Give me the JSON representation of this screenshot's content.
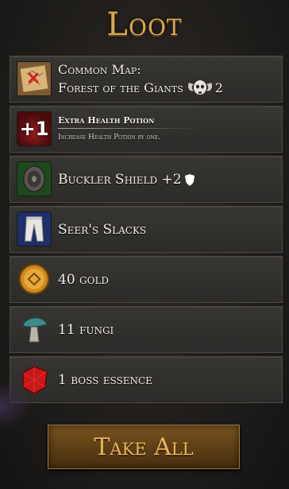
{
  "title": "Loot",
  "items": [
    {
      "lines": [
        "Common Map:",
        "Forest of the Giants"
      ],
      "count": "2",
      "icon": "map-icon"
    },
    {
      "badge": "+1",
      "name": "Extra Health Potion",
      "desc": "Increase Health Potion by one.",
      "icon": "health-potion-icon"
    },
    {
      "label": "Buckler Shield +2",
      "icon": "buckler-shield-icon"
    },
    {
      "label": "Seer's Slacks",
      "icon": "slacks-icon"
    },
    {
      "label": "40 gold",
      "icon": "gold-coin-icon"
    },
    {
      "label": "11 fungi",
      "icon": "mushroom-icon"
    },
    {
      "label": "1 boss essence",
      "icon": "boss-essence-icon"
    }
  ],
  "take_all": "Take All",
  "colors": {
    "gold": "#d9a84d",
    "button": "#5a3c14"
  }
}
